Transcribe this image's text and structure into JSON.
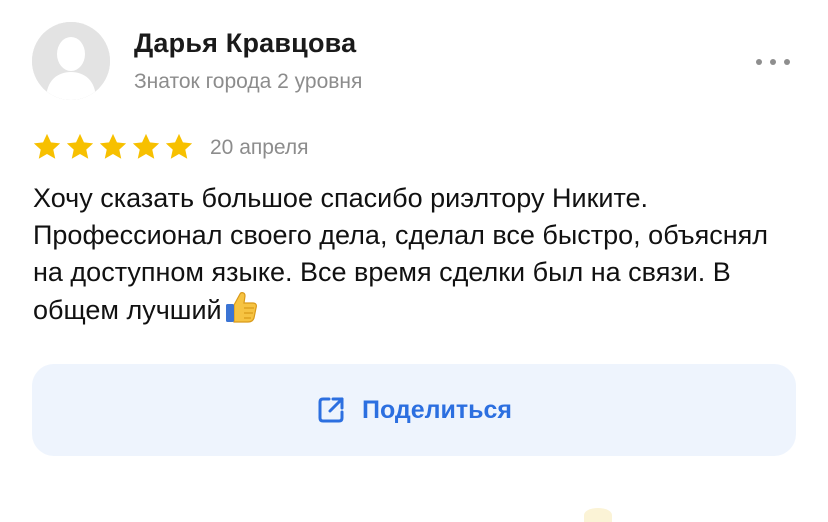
{
  "review": {
    "author_name": "Дарья Кравцова",
    "author_level": "Знаток города 2 уровня",
    "rating": 5,
    "rating_max": 5,
    "date": "20 апреля",
    "text": "Хочу сказать большое спасибо риэлтору Никите. Профессионал своего дела, сделал все быстро, объяснял на доступном языке. Все время сделки был на связи. В общем лучший"
  },
  "share": {
    "label": "Поделиться",
    "icon": "share-icon"
  },
  "icons": {
    "avatar": "user-avatar-placeholder",
    "more": "more-dots-icon",
    "star": "star-icon",
    "thumb": "thumbs-up-emoji"
  },
  "colors": {
    "star": "#f7c000",
    "share_text": "#2c6fe0",
    "share_bg": "#eef4fd",
    "meta_text": "#8c8c8c"
  }
}
